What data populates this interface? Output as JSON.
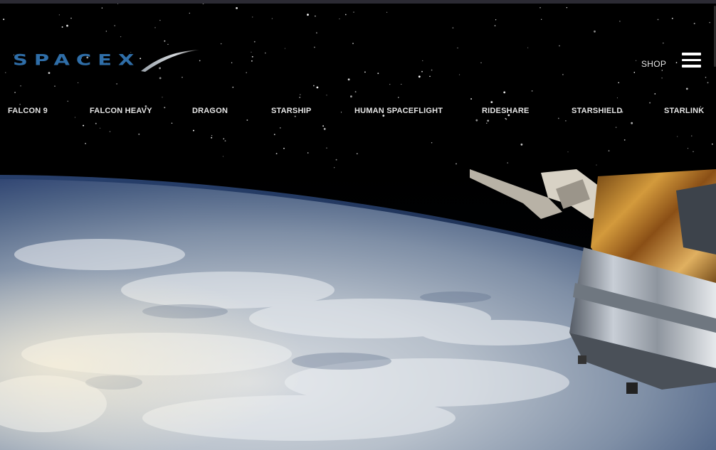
{
  "header": {
    "logo_text": "SPACEX",
    "shop_label": "SHOP",
    "menu_icon": "hamburger-menu-icon"
  },
  "nav": {
    "items": [
      {
        "label": "FALCON 9"
      },
      {
        "label": "FALCON HEAVY"
      },
      {
        "label": "DRAGON"
      },
      {
        "label": "STARSHIP"
      },
      {
        "label": "HUMAN SPACEFLIGHT"
      },
      {
        "label": "RIDESHARE"
      },
      {
        "label": "STARSHIELD"
      },
      {
        "label": "STARLINK"
      }
    ]
  },
  "colors": {
    "background": "#000000",
    "logo_blue": "#2f6ea8",
    "nav_text": "#e6e6e6"
  },
  "hero": {
    "image": "earth-from-orbit-with-spacecraft"
  }
}
